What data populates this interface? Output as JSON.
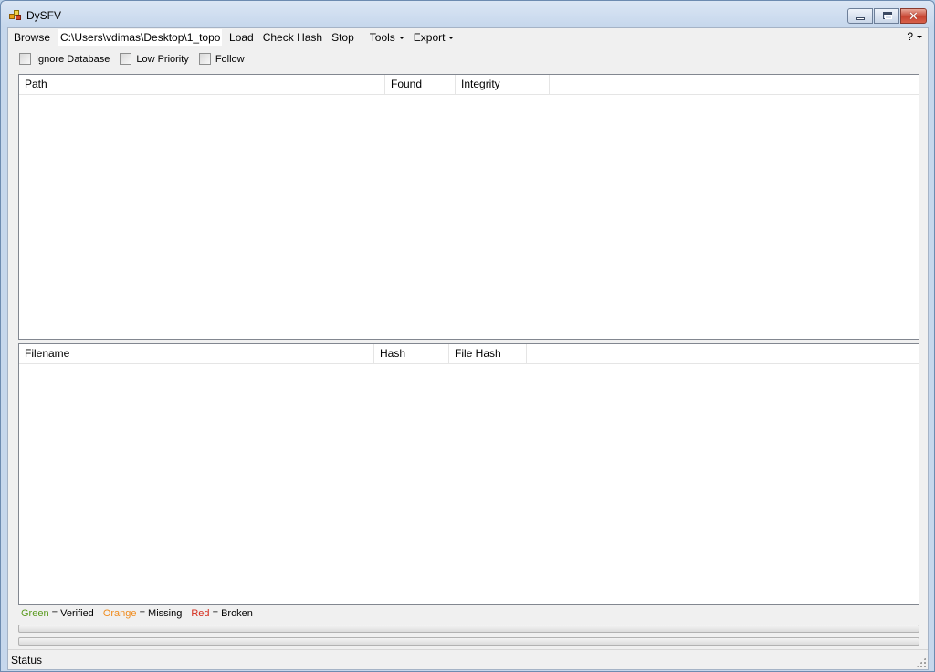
{
  "window": {
    "title": "DySFV"
  },
  "toolbar": {
    "browse": "Browse",
    "path_value": "C:\\Users\\vdimas\\Desktop\\1_topo",
    "load": "Load",
    "check_hash": "Check Hash",
    "stop": "Stop",
    "tools": "Tools",
    "export": "Export",
    "help": "?"
  },
  "options": [
    {
      "label": "Ignore Database",
      "checked": false
    },
    {
      "label": "Low Priority",
      "checked": false
    },
    {
      "label": "Follow",
      "checked": false
    }
  ],
  "path_list": {
    "columns": [
      "Path",
      "Found",
      "Integrity"
    ],
    "rows": []
  },
  "file_list": {
    "columns": [
      "Filename",
      "Hash",
      "File Hash"
    ],
    "rows": []
  },
  "legend": {
    "green": "Green",
    "green_desc": " = Verified",
    "orange": "Orange",
    "orange_desc": " = Missing",
    "red": "Red",
    "red_desc": " = Broken",
    "colors": {
      "green": "#5a9a1e",
      "orange": "#f08c1e",
      "red": "#d42a1a"
    }
  },
  "progress": {
    "primary": 0,
    "secondary": 0
  },
  "status": {
    "text": "Status"
  }
}
